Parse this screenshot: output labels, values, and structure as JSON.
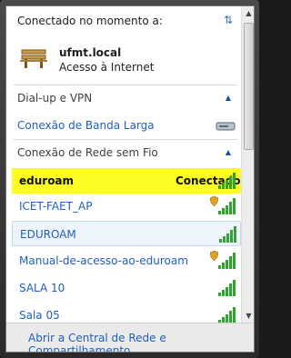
{
  "header": {
    "title": "Conectado no momento a:"
  },
  "current_network": {
    "name": "ufmt.local",
    "status": "Acesso à Internet"
  },
  "sections": {
    "dialup": {
      "title": "Dial-up e VPN",
      "items": [
        {
          "label": "Conexão de Banda Larga"
        }
      ]
    },
    "wireless": {
      "title": "Conexão de Rede sem Fio"
    }
  },
  "networks": [
    {
      "name": "eduroam",
      "status": "Conectado",
      "secured": false
    },
    {
      "name": "ICET-FAET_AP",
      "secured": true
    },
    {
      "name": "EDUROAM",
      "secured": false
    },
    {
      "name": "Manual-de-acesso-ao-eduroam",
      "secured": true
    },
    {
      "name": "SALA 10",
      "secured": false
    },
    {
      "name": "Sala 05",
      "secured": false
    }
  ],
  "footer": {
    "link": "Abrir a Central de Rede e Compartilhamento"
  },
  "icons": [
    "refresh-icon",
    "bench-icon",
    "chevron-up-icon",
    "modem-icon",
    "signal-icon",
    "shield-icon"
  ],
  "colors": {
    "highlight": "#fdfd24",
    "link": "#1f5fbf",
    "signal": "#2fa52f"
  }
}
